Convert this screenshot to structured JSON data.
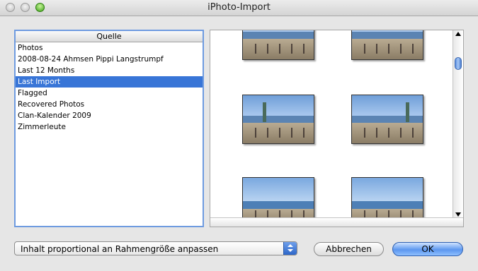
{
  "window": {
    "title": "iPhoto-Import"
  },
  "source_list": {
    "header": "Quelle",
    "items": [
      {
        "label": "Photos"
      },
      {
        "label": "2008-08-24 Ahmsen Pippi Langstrumpf"
      },
      {
        "label": "Last 12 Months"
      },
      {
        "label": "Last Import",
        "selected": true
      },
      {
        "label": "Flagged"
      },
      {
        "label": "Recovered Photos"
      },
      {
        "label": "Clan-Kalender 2009"
      },
      {
        "label": "Zimmerleute"
      }
    ]
  },
  "scaling_popup": {
    "selected": "Inhalt proportional an Rahmengröße anpassen"
  },
  "buttons": {
    "cancel": "Abbrechen",
    "ok": "OK"
  },
  "colors": {
    "selection": "#3875d7",
    "ok_button": "#5c97ef",
    "focus_ring": "#6e9be0"
  }
}
